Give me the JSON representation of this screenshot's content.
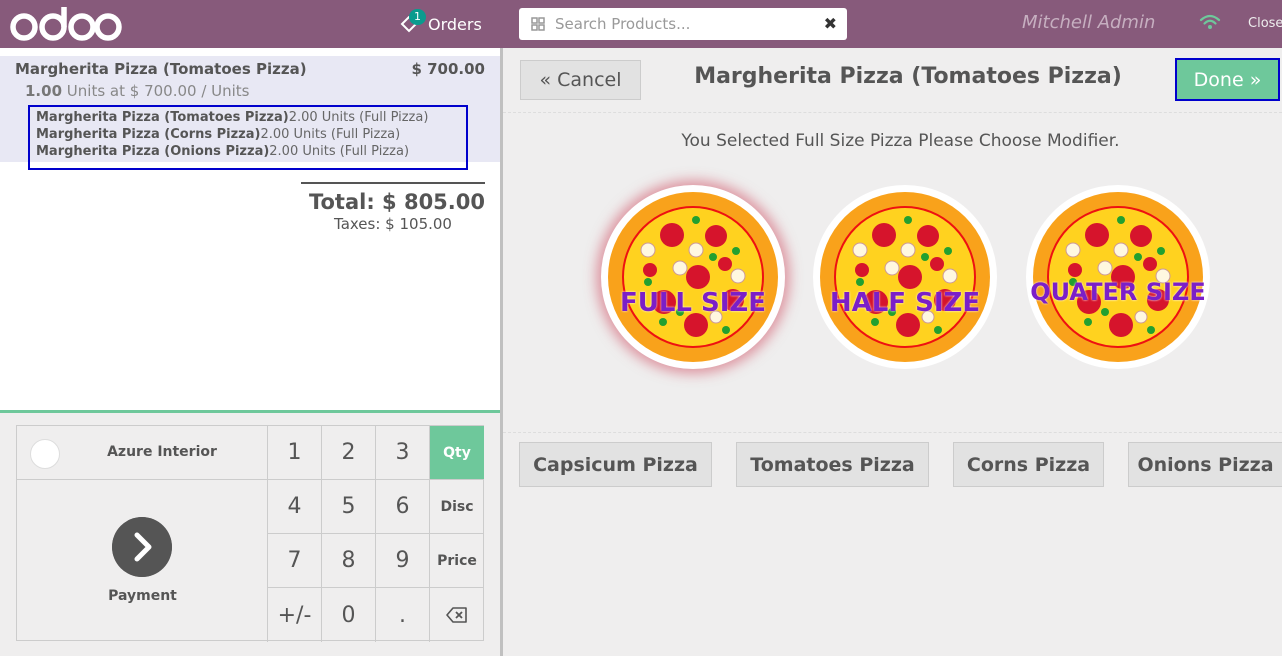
{
  "header": {
    "logo_text": "odoo",
    "orders_label": "Orders",
    "orders_badge": "1",
    "search_placeholder": "Search Products...",
    "user_name": "Mitchell Admin",
    "close_label": "Close"
  },
  "order": {
    "line": {
      "name": "Margherita Pizza (Tomatoes Pizza)",
      "price": "$ 700.00",
      "qty": "1.00",
      "units_text": "Units at $ 700.00 / Units",
      "sublines": [
        {
          "name": "Margherita Pizza (Tomatoes Pizza)",
          "detail": "2.00 Units (Full Pizza)"
        },
        {
          "name": "Margherita Pizza (Corns Pizza)",
          "detail": "2.00 Units (Full Pizza)"
        },
        {
          "name": "Margherita Pizza (Onions Pizza)",
          "detail": "2.00 Units (Full Pizza)"
        }
      ]
    },
    "total": "Total: $ 805.00",
    "taxes": "Taxes: $ 105.00"
  },
  "pad": {
    "customer": "Azure Interior",
    "payment": "Payment",
    "keys": [
      "1",
      "2",
      "3",
      "Qty",
      "4",
      "5",
      "6",
      "Disc",
      "7",
      "8",
      "9",
      "Price",
      "+/-",
      "0",
      ".",
      ""
    ],
    "active_mode": "Qty"
  },
  "popup": {
    "cancel_label": "« Cancel",
    "title": "Margherita Pizza (Tomatoes Pizza)",
    "done_label": "Done »",
    "instruction": "You Selected Full Size Pizza Please Choose Modifier.",
    "sizes": [
      {
        "label": "FULL SIZE",
        "selected": true
      },
      {
        "label": "HALF SIZE",
        "selected": false
      },
      {
        "label": "QUATER SIZE",
        "selected": false
      }
    ],
    "modifiers": [
      "Capsicum Pizza",
      "Tomatoes Pizza",
      "Corns Pizza",
      "Onions Pizza"
    ]
  },
  "colors": {
    "topbar": "#875a7b",
    "accent_green": "#6ec89b",
    "highlight_blue": "#0000cc",
    "label_purple": "#7b1fc8"
  },
  "icons": [
    "orders-tag-icon",
    "search-grid-icon",
    "clear-icon",
    "wifi-icon",
    "avatar",
    "chevron-right-icon",
    "backspace-icon"
  ]
}
